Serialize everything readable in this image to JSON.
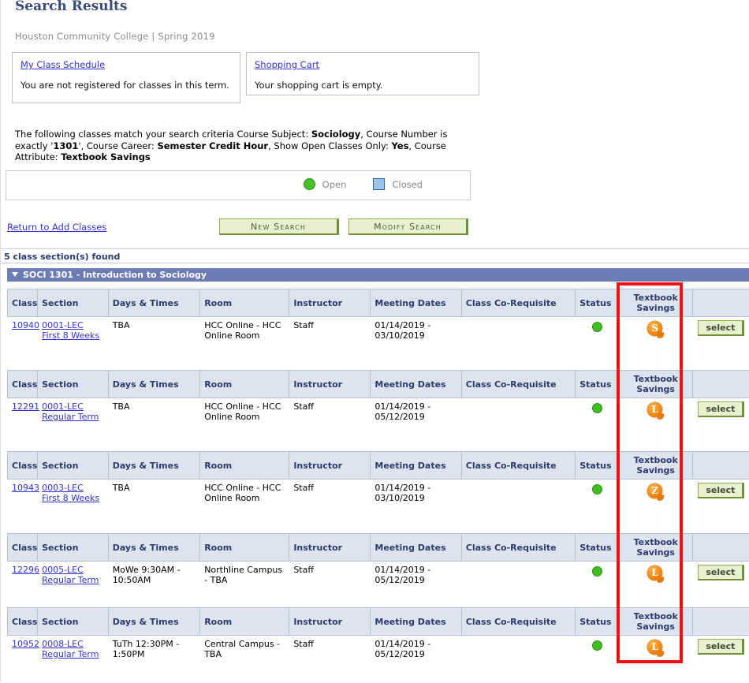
{
  "header": {
    "title": "Search Results",
    "subtitle": "Houston Community College | Spring 2019"
  },
  "panels": {
    "schedule": {
      "link": "My Class Schedule",
      "text": "You are not registered for classes in this term."
    },
    "cart": {
      "link": "Shopping Cart",
      "text": "Your shopping cart is empty."
    }
  },
  "criteria": {
    "lead": "The following classes match your search criteria Course Subject:",
    "subject": "Sociology",
    "number_label": ",  Course Number is exactly '",
    "number": "1301",
    "career_label": "',  Course Career:",
    "career": "Semester Credit Hour",
    "open_label": ",  Show Open Classes Only:",
    "open": "Yes",
    "attribute_label": ",  Course Attribute:",
    "attribute": "Textbook Savings"
  },
  "legend": {
    "open_label": "Open",
    "closed_label": "Closed",
    "open_color": "#45c025",
    "closed_color": "#9dc3e6"
  },
  "actions": {
    "return_link": "Return to Add Classes",
    "new_search": "New Search",
    "modify_search": "Modify Search"
  },
  "results": {
    "found": "5 class section(s) found",
    "course_header": "SOCI 1301 - Introduction to Sociology",
    "columns": [
      "Class",
      "Section",
      "Days & Times",
      "Room",
      "Instructor",
      "Meeting Dates",
      "Class Co-Requisite",
      "Status",
      "Textbook Savings",
      ""
    ],
    "select_label": "select",
    "rows": [
      {
        "class": "10940",
        "section_line1": "0001-LEC",
        "section_line2": "First 8 Weeks",
        "days_times": "TBA",
        "room": "HCC Online - HCC Online Room",
        "instructor": "Staff",
        "meeting_dates": "01/14/2019 - 03/10/2019",
        "co_requisite": "",
        "status": "open",
        "textbook_savings": "S"
      },
      {
        "class": "12291",
        "section_line1": "0001-LEC",
        "section_line2": "Regular Term",
        "days_times": "TBA",
        "room": "HCC Online - HCC Online Room",
        "instructor": "Staff",
        "meeting_dates": "01/14/2019 - 05/12/2019",
        "co_requisite": "",
        "status": "open",
        "textbook_savings": "L"
      },
      {
        "class": "10943",
        "section_line1": "0003-LEC",
        "section_line2": "First 8 Weeks",
        "days_times": "TBA",
        "room": "HCC Online - HCC Online Room",
        "instructor": "Staff",
        "meeting_dates": "01/14/2019 - 03/10/2019",
        "co_requisite": "",
        "status": "open",
        "textbook_savings": "Z"
      },
      {
        "class": "12296",
        "section_line1": "0005-LEC",
        "section_line2": "Regular Term",
        "days_times": "MoWe 9:30AM - 10:50AM",
        "room": "Northline Campus - TBA",
        "instructor": "Staff",
        "meeting_dates": "01/14/2019 - 05/12/2019",
        "co_requisite": "",
        "status": "open",
        "textbook_savings": "L"
      },
      {
        "class": "10952",
        "section_line1": "0008-LEC",
        "section_line2": "Regular Term",
        "days_times": "TuTh 12:30PM - 1:50PM",
        "room": "Central Campus - TBA",
        "instructor": "Staff",
        "meeting_dates": "01/14/2019 - 05/12/2019",
        "co_requisite": "",
        "status": "open",
        "textbook_savings": "L"
      }
    ]
  },
  "annotation": {
    "highlight_color": "#ee1111"
  }
}
